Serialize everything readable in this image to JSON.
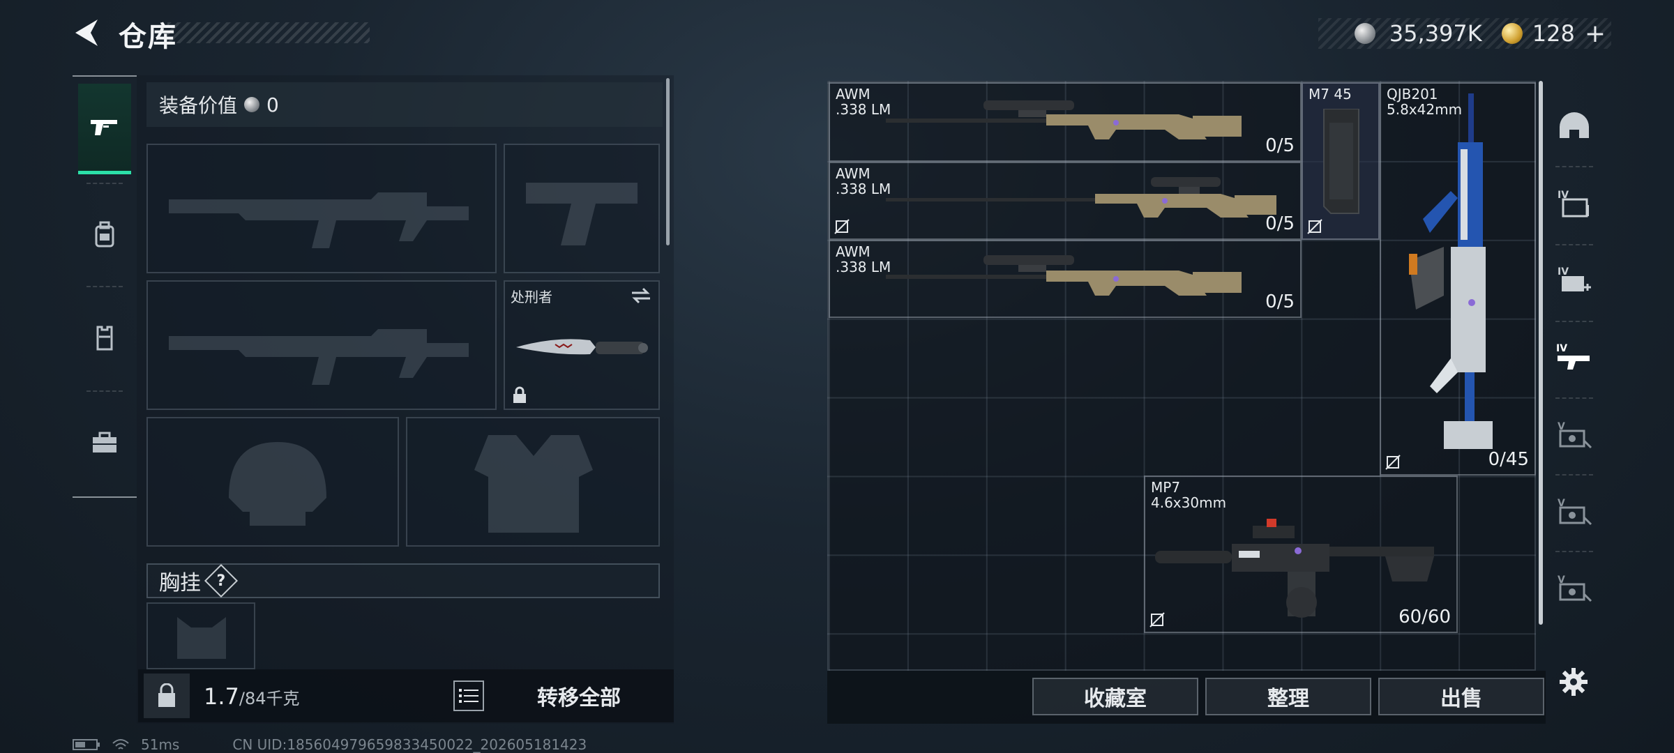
{
  "header": {
    "title": "仓库",
    "currency": [
      {
        "icon": "silver-coin-icon",
        "value": "35,397K"
      },
      {
        "icon": "gold-coin-icon",
        "value": "128"
      }
    ],
    "plus_label": "+"
  },
  "loadout": {
    "equip_value_label": "装备价值",
    "equip_value": "0",
    "melee_name": "处刑者",
    "chest_rig_label": "胸挂",
    "help_label": "?",
    "weight_current": "1.7",
    "weight_max": "/84千克",
    "transfer_all_label": "转移全部"
  },
  "storage": {
    "items": [
      {
        "name": "AWM\n.338 LM",
        "count": "0/5"
      },
      {
        "name": "AWM\n.338 LM",
        "count": "0/5"
      },
      {
        "name": "AWM\n.338 LM",
        "count": "0/5"
      },
      {
        "name": "M7 45",
        "count": ""
      },
      {
        "name": "QJB201\n5.8x42mm",
        "count": "0/45"
      },
      {
        "name": "MP7\n4.6x30mm",
        "count": "60/60"
      }
    ],
    "actions": {
      "collection": "收藏室",
      "sort": "整理",
      "sell": "出售"
    }
  },
  "sidebar_filters": [
    {
      "icon": "helmet-filter-icon"
    },
    {
      "icon": "ammo-box-iv-icon"
    },
    {
      "icon": "medkit-iv-icon"
    },
    {
      "icon": "gun-iv-icon"
    },
    {
      "icon": "item-v-icon"
    },
    {
      "icon": "item-v-icon-2"
    },
    {
      "icon": "item-v-icon-3"
    }
  ],
  "status_bar": {
    "ping": "51ms",
    "uid": "CN UID:185604979659833450022_202605181423"
  },
  "colors": {
    "accent": "#2ce0a8",
    "background": "#1a2530"
  }
}
